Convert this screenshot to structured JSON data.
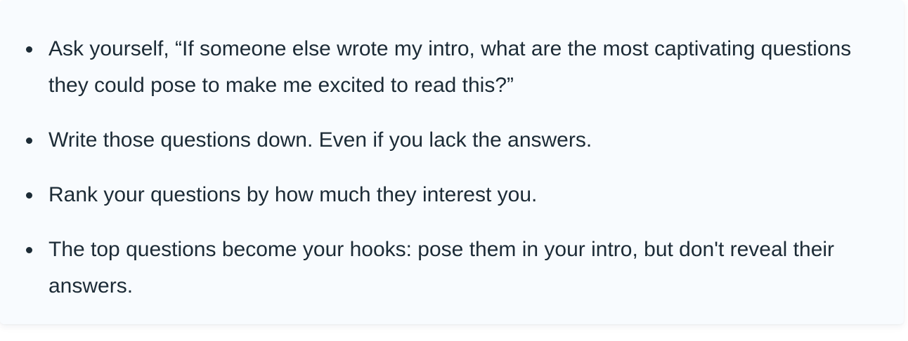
{
  "bullets": [
    {
      "text": "Ask yourself, “If someone else wrote my intro, what are the most captivating questions they could pose to make me excited to read this?”"
    },
    {
      "text": "Write those questions down. Even if you lack the answers."
    },
    {
      "text": "Rank your questions by how much they interest you."
    },
    {
      "text": "The top questions become your hooks: pose them in your intro, but don't reveal their answers."
    }
  ],
  "colors": {
    "text": "#1c2b36",
    "card_background": "#f8fbfe"
  }
}
